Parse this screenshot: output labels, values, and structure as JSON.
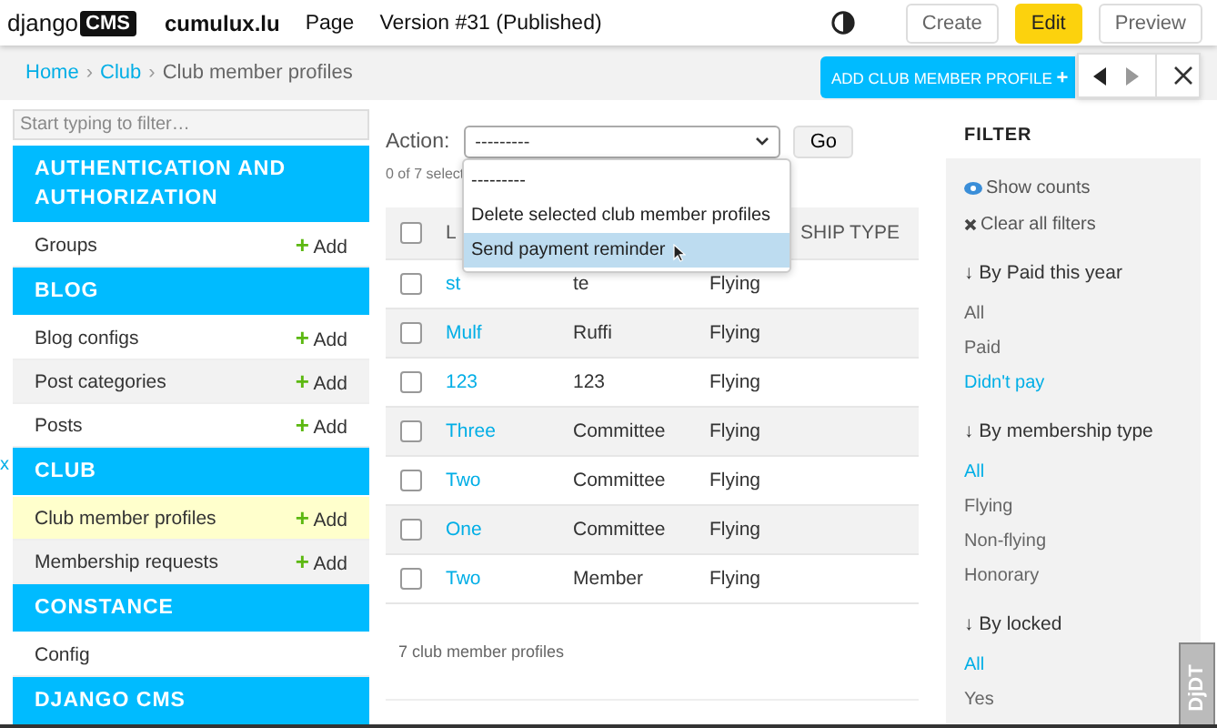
{
  "toolbar": {
    "logo_word": "django",
    "logo_badge": "CMS",
    "site": "cumulux.lu",
    "menu": [
      "Page",
      "Version #31 (Published)"
    ],
    "buttons": [
      {
        "label": "Create",
        "kind": "default"
      },
      {
        "label": "Edit",
        "kind": "primary"
      },
      {
        "label": "Preview",
        "kind": "default"
      }
    ]
  },
  "breadcrumbs": [
    {
      "label": "Home",
      "link": true
    },
    {
      "label": "Club",
      "link": true
    },
    {
      "label": "Club member profiles",
      "link": false
    }
  ],
  "breadcrumb_separators": [
    "›",
    "›"
  ],
  "add_button": {
    "label": "ADD CLUB MEMBER PROFILE",
    "icon": "+"
  },
  "sidebar": {
    "filter_placeholder": "Start typing to filter…",
    "collapse_toggle": "x",
    "apps": [
      {
        "name": "AUTHENTICATION AND AUTHORIZATION",
        "models": [
          {
            "name": "Groups",
            "add": "Add",
            "selected": false
          }
        ]
      },
      {
        "name": "BLOG",
        "models": [
          {
            "name": "Blog configs",
            "add": "Add",
            "selected": false
          },
          {
            "name": "Post categories",
            "add": "Add",
            "selected": false
          },
          {
            "name": "Posts",
            "add": "Add",
            "selected": false
          }
        ]
      },
      {
        "name": "CLUB",
        "models": [
          {
            "name": "Club member profiles",
            "add": "Add",
            "selected": true
          },
          {
            "name": "Membership requests",
            "add": "Add",
            "selected": false
          }
        ]
      },
      {
        "name": "CONSTANCE",
        "models": [
          {
            "name": "Config",
            "selected": false
          }
        ]
      },
      {
        "name": "DJANGO CMS"
      }
    ]
  },
  "actions": {
    "label": "Action:",
    "value": "---------",
    "go": "Go",
    "counter": "0 of 7 select",
    "options": [
      {
        "label": "---------",
        "highlighted": false
      },
      {
        "label": "Delete selected club member profiles",
        "highlighted": false
      },
      {
        "label": "Send payment reminder",
        "highlighted": true
      }
    ]
  },
  "table": {
    "column_1": "L",
    "column_3": "SHIP TYPE",
    "header_checked": false,
    "rows": [
      {
        "checked": false,
        "cells": [
          "st",
          "te",
          "Flying"
        ]
      },
      {
        "checked": false,
        "cells": [
          "Mulf",
          "Ruffi",
          "Flying"
        ]
      },
      {
        "checked": false,
        "cells": [
          "123",
          "123",
          "Flying"
        ]
      },
      {
        "checked": false,
        "cells": [
          "Three",
          "Committee",
          "Flying"
        ]
      },
      {
        "checked": false,
        "cells": [
          "Two",
          "Committee",
          "Flying"
        ]
      },
      {
        "checked": false,
        "cells": [
          "One",
          "Committee",
          "Flying"
        ]
      },
      {
        "checked": false,
        "cells": [
          "Two",
          "Member",
          "Flying"
        ]
      }
    ],
    "footer": "7 club member profiles"
  },
  "filter": {
    "title": "FILTER",
    "show_counts": "Show counts",
    "clear_all": "Clear all filters",
    "groups": [
      {
        "title": "↓ By Paid this year",
        "options": [
          {
            "label": "All",
            "selected": false
          },
          {
            "label": "Paid",
            "selected": false
          },
          {
            "label": "Didn't pay",
            "selected": true
          }
        ]
      },
      {
        "title": "↓ By membership type",
        "options": [
          {
            "label": "All",
            "selected": true
          },
          {
            "label": "Flying",
            "selected": false
          },
          {
            "label": "Non-flying",
            "selected": false
          },
          {
            "label": "Honorary",
            "selected": false
          }
        ]
      },
      {
        "title": "↓ By locked",
        "options": [
          {
            "label": "All",
            "selected": true
          },
          {
            "label": "Yes",
            "selected": false
          }
        ]
      }
    ]
  },
  "debug_handle": "DjDT"
}
